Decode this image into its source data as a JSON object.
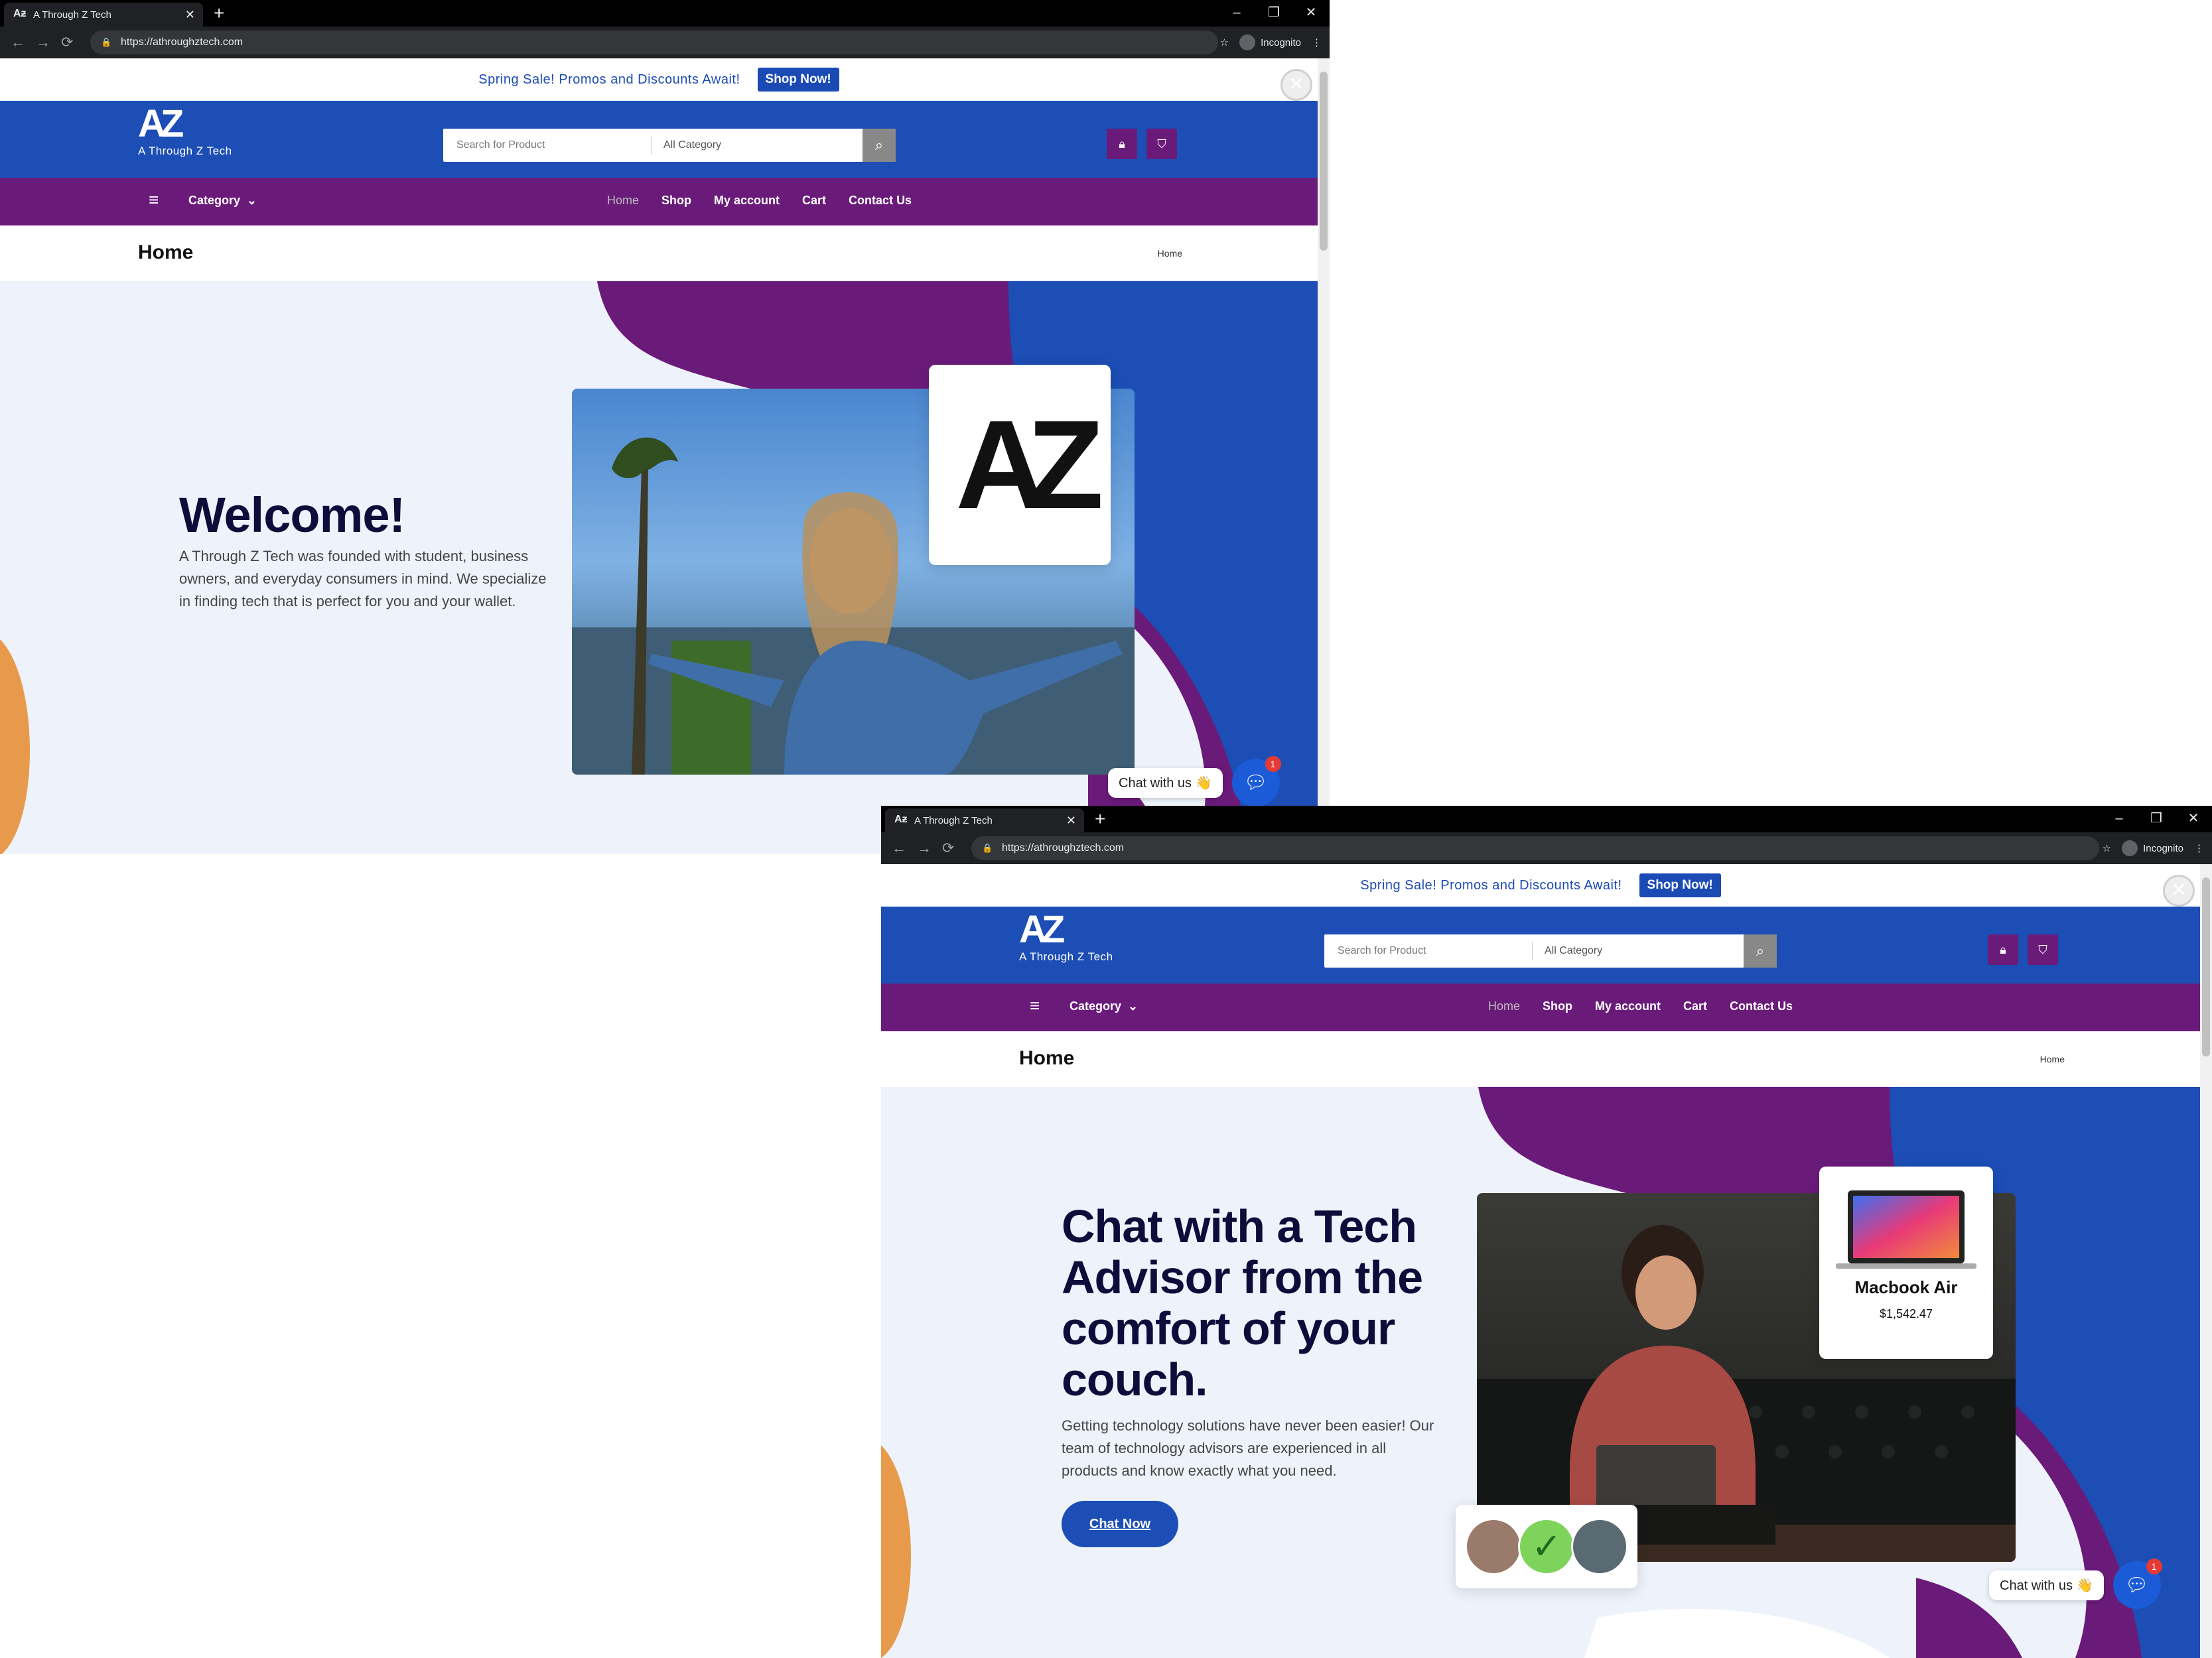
{
  "browser": {
    "tab_title": "A Through Z Tech",
    "url": "https://athroughztech.com",
    "incognito_label": "Incognito",
    "new_tab": "+",
    "tab_close": "✕",
    "win_min": "–",
    "win_restore": "❐",
    "win_close": "✕"
  },
  "promo": {
    "text": "Spring Sale! Promos and Discounts Await!",
    "button": "Shop Now!"
  },
  "header": {
    "logo_mark": "AZ",
    "logo_text": "A Through Z Tech",
    "search_placeholder": "Search for Product",
    "category_select": "All Category"
  },
  "nav": {
    "category": "Category",
    "items": [
      "Home",
      "Shop",
      "My account",
      "Cart",
      "Contact Us"
    ]
  },
  "page_title": "Home",
  "breadcrumb": "Home",
  "hero1": {
    "title": "Welcome!",
    "text": "A Through Z Tech was founded with student, business owners, and everyday consumers in mind. We specialize in finding tech that is perfect for you and your wallet.",
    "logo_card_mark": "AZ"
  },
  "hero2": {
    "title": "Chat with a Tech Advisor from the comfort of your couch.",
    "text": "Getting technology solutions have never been easier! Our team of technology advisors are experienced in all products and know exactly what you need.",
    "button": "Chat Now",
    "product_name": "Macbook Air",
    "product_price": "$1,542.47"
  },
  "chat_widget": {
    "label": "Chat with us 👋",
    "badge": "1"
  },
  "colors": {
    "header_blue": "#1c4eb6",
    "nav_purple": "#6a1b7a",
    "hero_bg": "#eef3fb",
    "title_navy": "#0e0c3a",
    "accent_orange": "#e89a4c"
  }
}
